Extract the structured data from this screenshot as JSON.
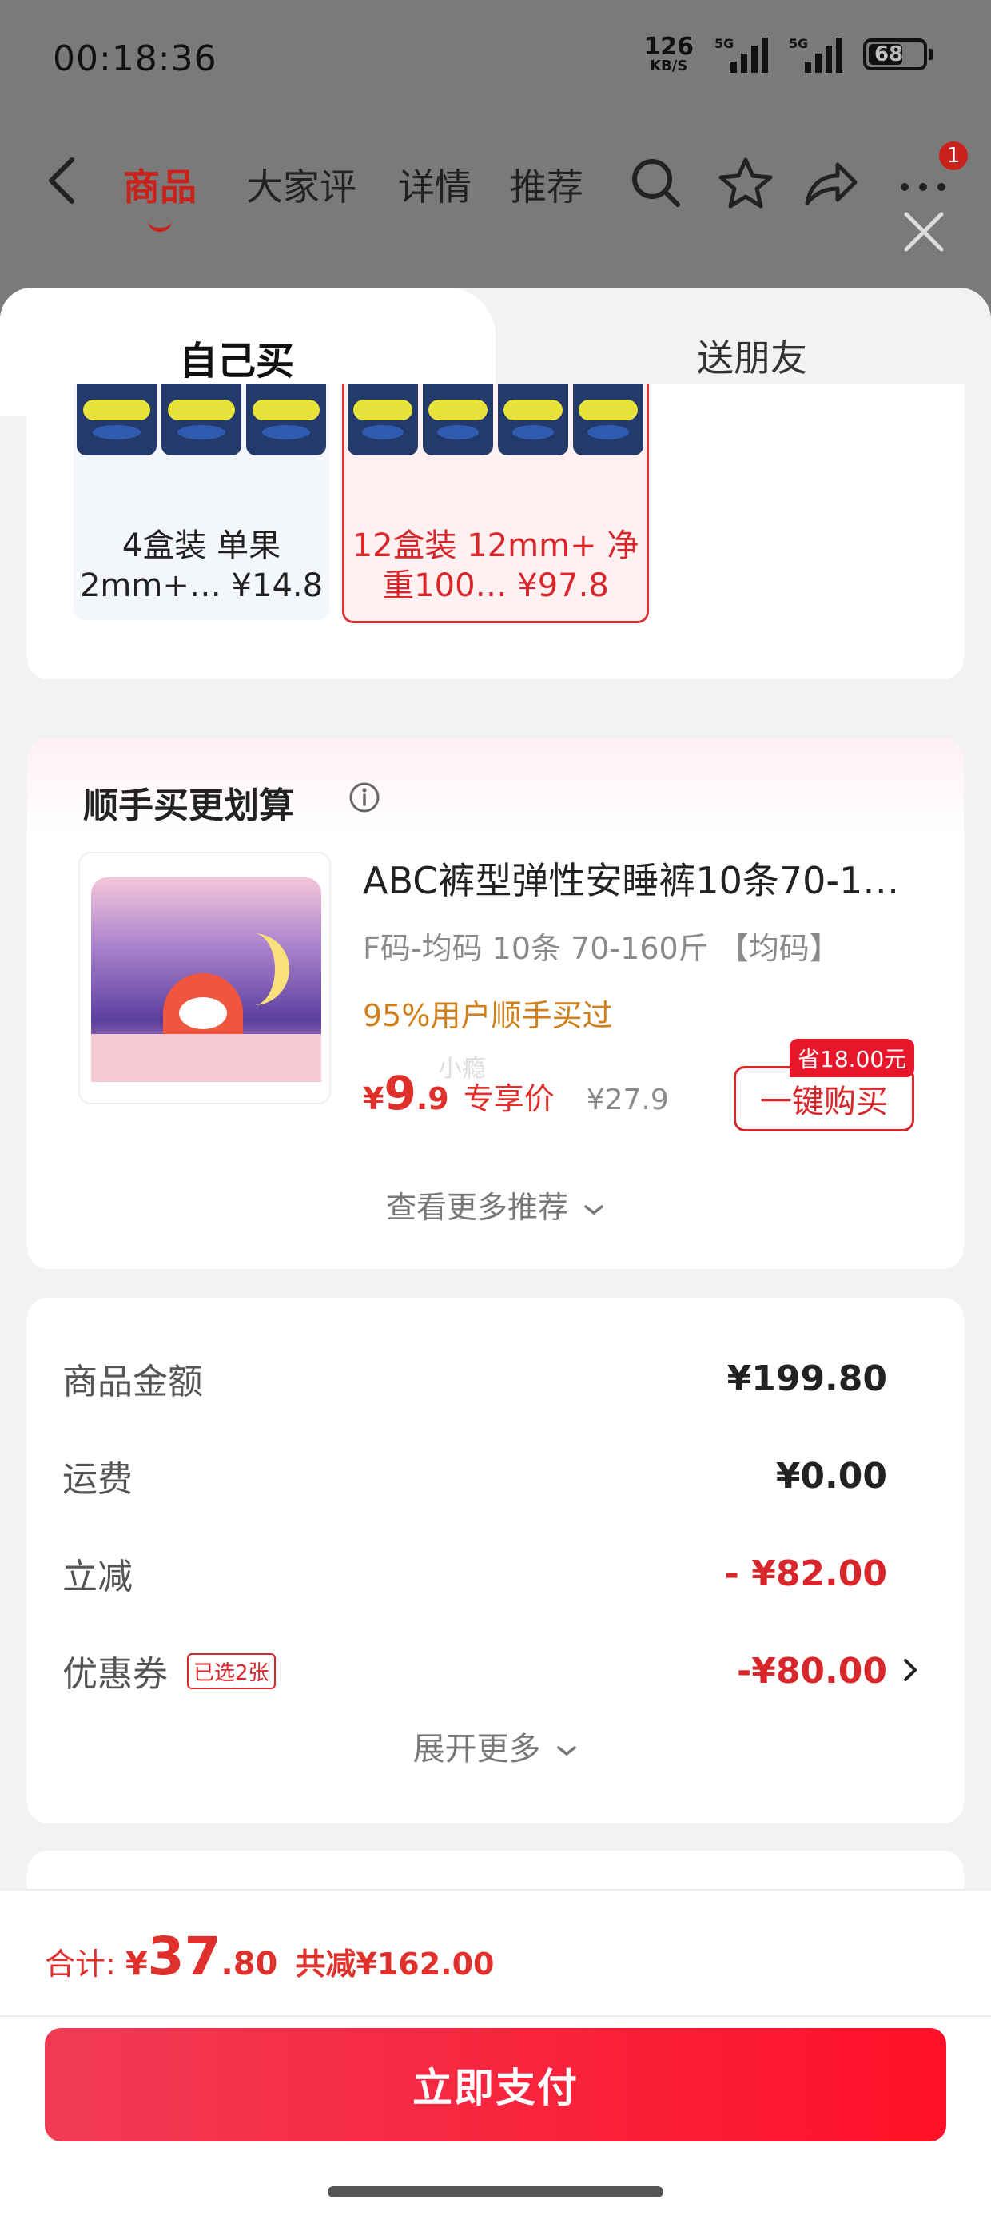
{
  "status_bar": {
    "time": "00:18:36",
    "net_speed": "126",
    "net_unit": "KB/S",
    "signal1_label": "5G",
    "signal2_label": "5G",
    "battery": "68"
  },
  "nav": {
    "tabs": [
      "商品",
      "大家评",
      "详情",
      "推荐"
    ],
    "badge_count": "1"
  },
  "sheet_tabs": {
    "self": "自己买",
    "gift": "送朋友"
  },
  "variants": [
    {
      "label": "4盒装 单果\n2mm+… ¥14.8",
      "selected": false
    },
    {
      "label": "12盒装 12mm+ 净\n重100… ¥97.8",
      "selected": true
    }
  ],
  "addon": {
    "title": "顺手买更划算",
    "product_name": "ABC裤型弹性安睡裤10条70-1…",
    "spec": "F码-均码 10条 70-160斤 【均码】",
    "rate": "95%用户顺手买过",
    "watermark": "小瘾",
    "price_symbol": "¥",
    "price_int": "9",
    "price_dec": ".9",
    "price_tag": "专享价",
    "orig_price": "¥27.9",
    "save_tag": "省18.00元",
    "buy_label": "一键购买",
    "more_label": "查看更多推荐"
  },
  "summary": {
    "rows": [
      {
        "label": "商品金额",
        "value": "¥199.80",
        "red": false
      },
      {
        "label": "运费",
        "value": "¥0.00",
        "red": false
      },
      {
        "label": "立减",
        "value": "- ¥82.00",
        "red": true
      },
      {
        "label": "优惠券",
        "value": "-¥80.00",
        "red": true,
        "tag": "已选2张"
      }
    ],
    "expand_label": "展开更多"
  },
  "footer": {
    "total_label": "合计:",
    "total_symbol": "¥",
    "total_int": "37",
    "total_dec": ".80",
    "saved": "共减¥162.00",
    "pay_label": "立即支付"
  },
  "colors": {
    "accent_red": "#d8262b",
    "pay_button": "#ff1028",
    "overlay": "#7a7a7a"
  }
}
